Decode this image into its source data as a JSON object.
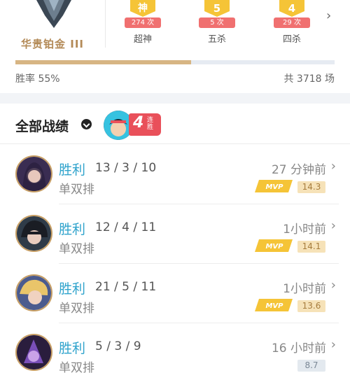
{
  "profile": {
    "rank_name": "华贵铂金 III",
    "honors": [
      {
        "icon": "神",
        "count": "274 次",
        "label": "超神"
      },
      {
        "icon": "5",
        "count": "5 次",
        "label": "五杀"
      },
      {
        "icon": "4",
        "count": "29 次",
        "label": "四杀"
      }
    ],
    "win_rate_label": "胜率 55%",
    "win_rate": 0.55,
    "total_label": "共 3718 场"
  },
  "section": {
    "title": "全部战绩",
    "streak_number": "4",
    "streak_text": "连胜"
  },
  "matches": [
    {
      "result": "胜利",
      "kda": "13 / 3 / 10",
      "mode": "单双排",
      "time": "27 分钟前",
      "mvp": "MVP",
      "score": "14.3",
      "score_style": "gold"
    },
    {
      "result": "胜利",
      "kda": "12 / 4 / 11",
      "mode": "单双排",
      "time": "1小时前",
      "mvp": "MVP",
      "score": "14.1",
      "score_style": "gold"
    },
    {
      "result": "胜利",
      "kda": "21 / 5 / 11",
      "mode": "单双排",
      "time": "1小时前",
      "mvp": "MVP",
      "score": "13.6",
      "score_style": "gold"
    },
    {
      "result": "胜利",
      "kda": "5 / 3 / 9",
      "mode": "单双排",
      "time": "16 小时前",
      "mvp": "",
      "score": "8.7",
      "score_style": "grey"
    }
  ],
  "colors": {
    "win": "#2fa3cc",
    "gold_accent": "#d7b583",
    "streak": "#e9505a"
  }
}
